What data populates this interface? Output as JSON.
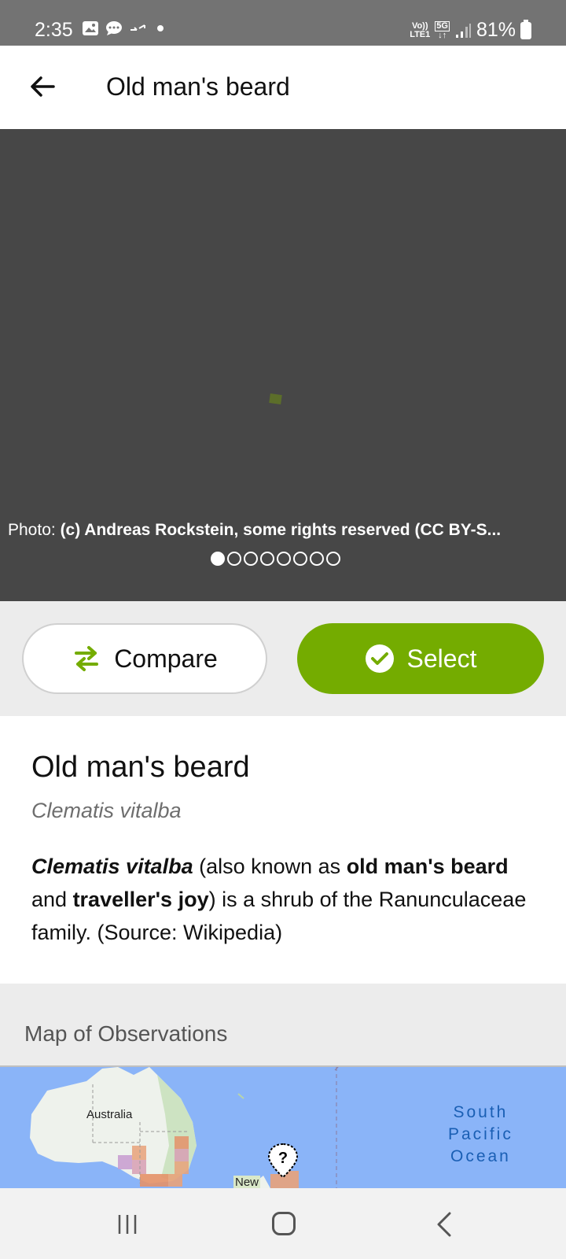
{
  "status_bar": {
    "time": "2:35",
    "volte": "Vo))",
    "lte": "LTE1",
    "network": "5G",
    "battery": "81%"
  },
  "app_bar": {
    "title": "Old man's beard",
    "back_icon": "arrow-left-icon"
  },
  "photo": {
    "credit_prefix": "Photo: ",
    "credit_text": "(c) Andreas Rockstein, some rights reserved (CC BY-S...",
    "pager_total": 8,
    "pager_active": 0
  },
  "actions": {
    "compare_label": "Compare",
    "compare_icon": "swap-arrows-icon",
    "select_label": "Select",
    "select_icon": "check-circle-icon"
  },
  "species": {
    "common_name": "Old man's beard",
    "scientific_name": "Clematis vitalba",
    "desc_sci": "Clematis vitalba",
    "desc_part1": " (also known as ",
    "desc_bold1": "old man's beard",
    "desc_part2": " and ",
    "desc_bold2": "traveller's joy",
    "desc_part3": ") is a shrub of the Ranunculaceae family. (Source: Wikipedia)"
  },
  "map": {
    "title": "Map of Observations",
    "label_australia": "Australia",
    "label_ocean_1": "South",
    "label_ocean_2": "Pacific",
    "label_ocean_3": "Ocean",
    "label_new": "New"
  },
  "colors": {
    "accent": "#74ac00",
    "photo_bg": "#474747",
    "status_bar": "#737373",
    "map_water": "#8ab4f8"
  }
}
